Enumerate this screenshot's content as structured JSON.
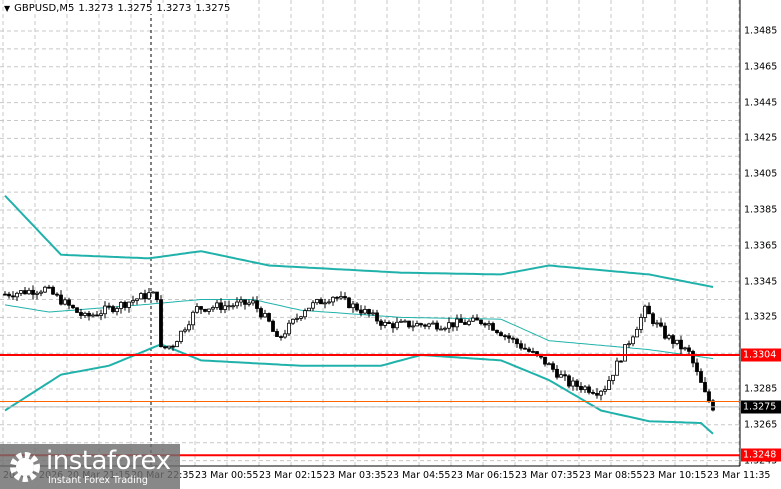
{
  "header": {
    "symbol": "GBPUSD,M5",
    "open": "1.3273",
    "high": "1.3275",
    "low": "1.3273",
    "close": "1.3275"
  },
  "price_axis": {
    "labels": [
      "1.3485",
      "1.3465",
      "1.3445",
      "1.3425",
      "1.3405",
      "1.3385",
      "1.3365",
      "1.3345",
      "1.3325",
      "1.3285",
      "1.3265",
      "1.3245"
    ],
    "max": 1.3485,
    "min": 1.3227
  },
  "levels": [
    {
      "name": "resistance",
      "price": 1.3304,
      "label": "1.3304",
      "color": "#ff0000"
    },
    {
      "name": "support",
      "price": 1.3248,
      "label": "1.3248",
      "color": "#ff0000"
    },
    {
      "name": "current",
      "price": 1.3275,
      "label": "1.3275",
      "color": "#000000"
    }
  ],
  "bid_line": {
    "price": 1.3278,
    "color": "#ff6600"
  },
  "time_axis": {
    "labels": [
      "20 Mar 2026",
      "20 Mar 21:15",
      "20 Mar 22:35",
      "23 Mar 00:55",
      "23 Mar 02:15",
      "23 Mar 03:35",
      "23 Mar 04:55",
      "23 Mar 06:15",
      "23 Mar 07:35",
      "23 Mar 08:55",
      "23 Mar 10:15",
      "23 Mar 11:35"
    ]
  },
  "chart_data": {
    "type": "candlestick",
    "title": "GBPUSD,M5",
    "candle_count": 178,
    "close_knots": [
      [
        0,
        1.3338
      ],
      [
        10,
        1.3341
      ],
      [
        18,
        1.3328
      ],
      [
        20,
        1.3325
      ],
      [
        30,
        1.3333
      ],
      [
        36,
        1.3338
      ],
      [
        38,
        1.3337
      ],
      [
        39,
        1.3307
      ],
      [
        42,
        1.331
      ],
      [
        48,
        1.333
      ],
      [
        62,
        1.3333
      ],
      [
        66,
        1.3322
      ],
      [
        68,
        1.3312
      ],
      [
        75,
        1.333
      ],
      [
        82,
        1.3337
      ],
      [
        90,
        1.3328
      ],
      [
        95,
        1.3321
      ],
      [
        110,
        1.3321
      ],
      [
        120,
        1.3323
      ],
      [
        127,
        1.3312
      ],
      [
        135,
        1.33
      ],
      [
        141,
        1.3288
      ],
      [
        148,
        1.3284
      ],
      [
        150,
        1.3286
      ],
      [
        154,
        1.3303
      ],
      [
        160,
        1.3329
      ],
      [
        165,
        1.3315
      ],
      [
        171,
        1.3305
      ],
      [
        175,
        1.3282
      ],
      [
        177,
        1.3275
      ]
    ],
    "bollinger_upper": [
      [
        0,
        1.3393
      ],
      [
        14,
        1.336
      ],
      [
        36,
        1.3358
      ],
      [
        49,
        1.3362
      ],
      [
        66,
        1.3354
      ],
      [
        99,
        1.335
      ],
      [
        124,
        1.3349
      ],
      [
        136,
        1.3354
      ],
      [
        161,
        1.3349
      ],
      [
        177,
        1.3342
      ]
    ],
    "bollinger_middle": [
      [
        0,
        1.3332
      ],
      [
        11,
        1.3328
      ],
      [
        34,
        1.3332
      ],
      [
        49,
        1.3335
      ],
      [
        62,
        1.3335
      ],
      [
        74,
        1.3329
      ],
      [
        99,
        1.3325
      ],
      [
        124,
        1.3324
      ],
      [
        136,
        1.3312
      ],
      [
        161,
        1.3307
      ],
      [
        177,
        1.3302
      ]
    ],
    "bollinger_lower": [
      [
        0,
        1.3273
      ],
      [
        14,
        1.3293
      ],
      [
        26,
        1.3298
      ],
      [
        39,
        1.331
      ],
      [
        49,
        1.3301
      ],
      [
        74,
        1.3298
      ],
      [
        94,
        1.3298
      ],
      [
        104,
        1.3304
      ],
      [
        124,
        1.3301
      ],
      [
        136,
        1.329
      ],
      [
        149,
        1.3273
      ],
      [
        161,
        1.3267
      ],
      [
        174,
        1.3266
      ],
      [
        177,
        1.326
      ]
    ],
    "band_color": "#20b2aa"
  },
  "watermark": {
    "brand": "instaforex",
    "tagline": "Instant Forex Trading"
  }
}
